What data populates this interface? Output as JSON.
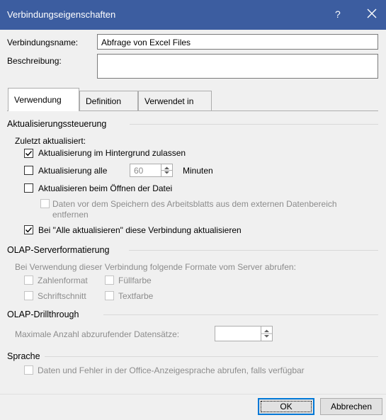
{
  "window": {
    "title": "Verbindungseigenschaften",
    "help_label": "?"
  },
  "connection": {
    "name_label": "Verbindungsname:",
    "name_value": "Abfrage von Excel Files",
    "description_label": "Beschreibung:",
    "description_value": ""
  },
  "tabs": [
    {
      "label": "Verwendung",
      "active": true
    },
    {
      "label": "Definition",
      "active": false
    },
    {
      "label": "Verwendet in",
      "active": false
    }
  ],
  "refresh": {
    "section_title": "Aktualisierungssteuerung",
    "last_refreshed_label": "Zuletzt aktualisiert:",
    "background_label": "Aktualisierung im Hintergrund zulassen",
    "background_checked": true,
    "interval_label": "Aktualisierung alle",
    "interval_checked": false,
    "interval_value": "60",
    "interval_unit": "Minuten",
    "on_open_label": "Aktualisieren beim Öffnen der Datei",
    "on_open_checked": false,
    "remove_data_label_line1": "Daten vor dem Speichern des Arbeitsblatts aus dem externen Datenbereich",
    "remove_data_label_line2": "entfernen",
    "remove_data_checked": false,
    "refresh_all_label": "Bei \"Alle aktualisieren\" diese Verbindung aktualisieren",
    "refresh_all_checked": true
  },
  "olap_format": {
    "section_title": "OLAP-Serverformatierung",
    "intro": "Bei Verwendung dieser Verbindung folgende Formate vom Server abrufen:",
    "number_format": "Zahlenformat",
    "fill_color": "Füllfarbe",
    "font_style": "Schriftschnitt",
    "text_color": "Textfarbe"
  },
  "olap_drill": {
    "section_title": "OLAP-Drillthrough",
    "max_records_label": "Maximale Anzahl abzurufender Datensätze:",
    "max_records_value": ""
  },
  "language": {
    "section_title": "Sprache",
    "option_label": "Daten und Fehler in der Office-Anzeigesprache abrufen, falls verfügbar"
  },
  "buttons": {
    "ok": "OK",
    "cancel": "Abbrechen"
  },
  "colors": {
    "titlebar": "#3c5da0",
    "dialog_bg": "#f0f0f0",
    "focus_border": "#0078d7",
    "disabled_text": "#8c8c8c"
  }
}
